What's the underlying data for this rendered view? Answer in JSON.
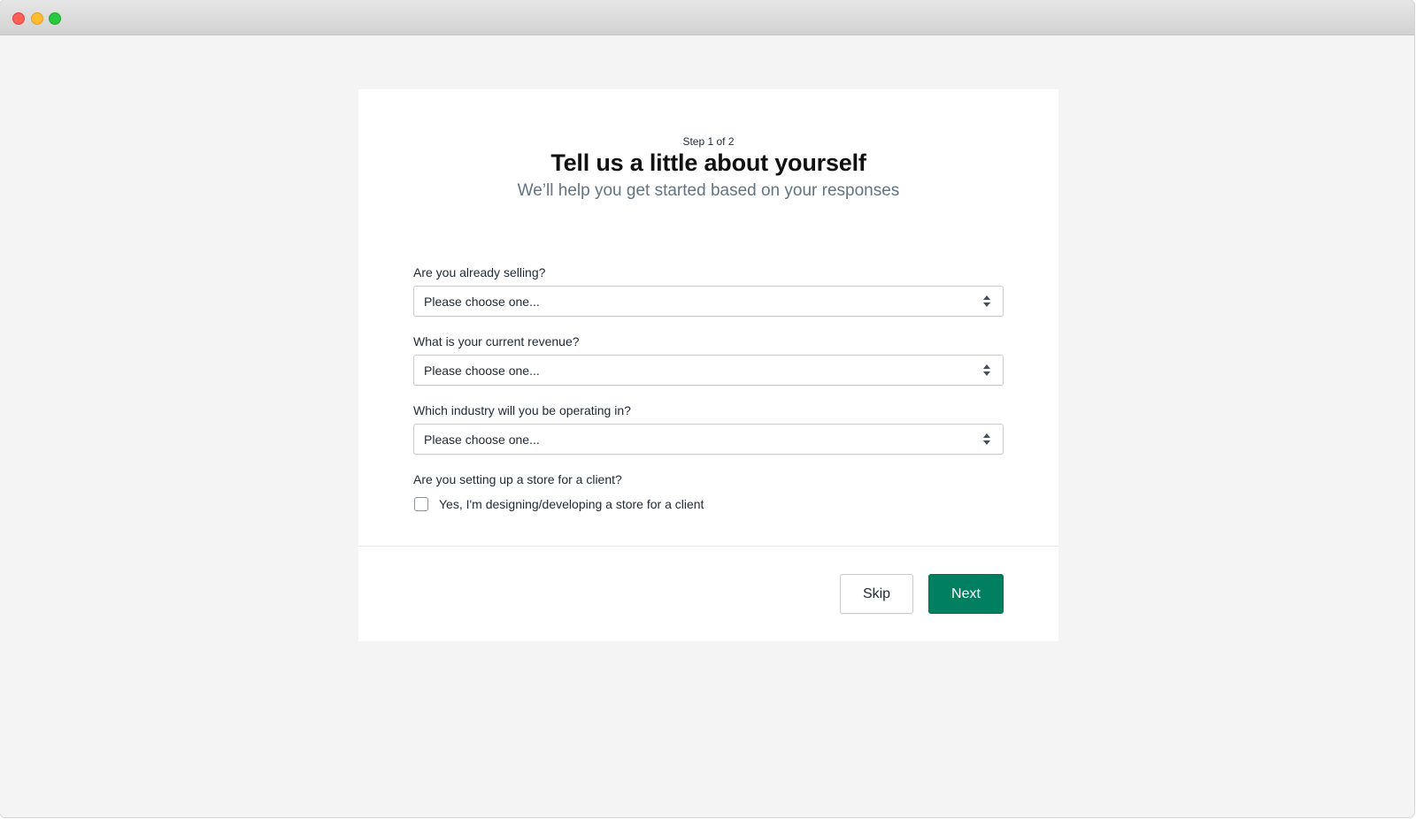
{
  "window": {
    "traffic_lights": [
      {
        "name": "close",
        "color": "#fe5f57"
      },
      {
        "name": "minimize",
        "color": "#febc2e"
      },
      {
        "name": "maximize",
        "color": "#28c840"
      }
    ]
  },
  "header": {
    "step": "Step 1 of 2",
    "title": "Tell us a little about yourself",
    "subtitle": "We’ll help you get started based on your responses"
  },
  "form": {
    "fields": [
      {
        "label": "Are you already selling?",
        "value": "Please choose one..."
      },
      {
        "label": "What is your current revenue?",
        "value": "Please choose one..."
      },
      {
        "label": "Which industry will you be operating in?",
        "value": "Please choose one..."
      }
    ],
    "client": {
      "label": "Are you setting up a store for a client?",
      "checkbox_label": "Yes, I'm designing/developing a store for a client",
      "checked": false
    }
  },
  "footer": {
    "skip_label": "Skip",
    "next_label": "Next"
  },
  "colors": {
    "primary": "#008060",
    "background": "#f4f4f4",
    "subtitle": "#637381"
  }
}
